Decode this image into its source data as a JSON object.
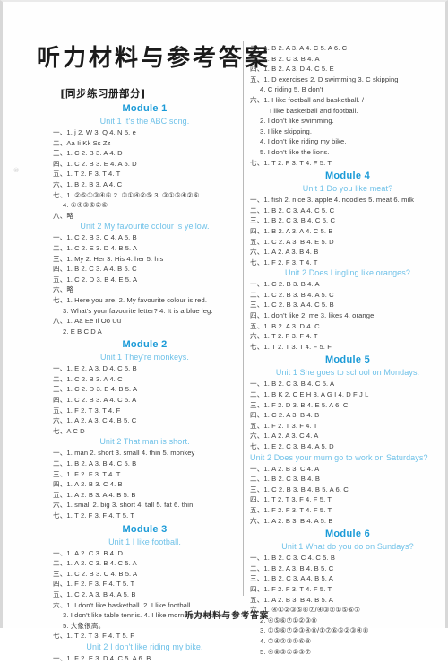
{
  "document": {
    "title": "听力材料与参考答案",
    "section_tag": "[同步练习册部分]",
    "footer": "听力材料与参考答案",
    "watermark": "",
    "edge_mark": "⑩",
    "accent_color": "#1a9ad7",
    "unit_color": "#6ec1e8"
  },
  "left_column": [
    {
      "type": "module",
      "text": "Module 1"
    },
    {
      "type": "unit",
      "text": "Unit 1   It's the ABC song."
    },
    {
      "type": "answer",
      "text": "一、1. j   2. W   3. Q   4. N   5. e"
    },
    {
      "type": "answer",
      "text": "二、Aa   Ii   Kk   Ss   Zz"
    },
    {
      "type": "answer",
      "text": "三、1. C   2. B   3. A   4. D"
    },
    {
      "type": "answer",
      "text": "四、1. C   2. B   3. E   4. A   5. D"
    },
    {
      "type": "answer",
      "text": "五、1. T   2. F   3. T   4. T"
    },
    {
      "type": "answer",
      "text": "六、1. B   2. B   3. A   4. C"
    },
    {
      "type": "answer",
      "text": "七、1. ②⑤①③④⑥   2. ③①④②⑤   3. ③①⑤④②⑥"
    },
    {
      "type": "answer_indent",
      "text": "4. ①④③⑤②⑥"
    },
    {
      "type": "answer",
      "text": "八、略"
    },
    {
      "type": "unit",
      "text": "Unit 2   My favourite colour is yellow."
    },
    {
      "type": "answer",
      "text": "一、1. C   2. B   3. C   4. A   5. B"
    },
    {
      "type": "answer",
      "text": "二、1. C   2. E   3. D   4. B   5. A"
    },
    {
      "type": "answer",
      "text": "三、1. My   2. Her   3. His   4. her   5. his"
    },
    {
      "type": "answer",
      "text": "四、1. B   2. C   3. A   4. B   5. C"
    },
    {
      "type": "answer",
      "text": "五、1. C   2. D   3. B   4. E   5. A"
    },
    {
      "type": "answer",
      "text": "六、略"
    },
    {
      "type": "answer",
      "text": "七、1. Here you are.    2. My favourite colour is red."
    },
    {
      "type": "answer_indent",
      "text": "3. What's your favourite letter?    4. It is a blue leg."
    },
    {
      "type": "answer",
      "text": "八、1. Aa   Ee   Ii   Oo   Uu"
    },
    {
      "type": "answer_indent",
      "text": "2. E   B   C   D   A"
    },
    {
      "type": "module",
      "text": "Module 2"
    },
    {
      "type": "unit",
      "text": "Unit 1   They're monkeys."
    },
    {
      "type": "answer",
      "text": "一、1. E   2. A   3. D   4. C   5. B"
    },
    {
      "type": "answer",
      "text": "二、1. C   2. B   3. A   4. C"
    },
    {
      "type": "answer",
      "text": "三、1. C   2. D   3. E   4. B   5. A"
    },
    {
      "type": "answer",
      "text": "四、1. C   2. B   3. A   4. C   5. A"
    },
    {
      "type": "answer",
      "text": "五、1. F   2. T   3. T   4. F"
    },
    {
      "type": "answer",
      "text": "六、1. A   2. A   3. C   4. B   5. C"
    },
    {
      "type": "answer",
      "text": "七、A   C   D"
    },
    {
      "type": "unit",
      "text": "Unit 2   That man is short."
    },
    {
      "type": "answer",
      "text": "一、1. man   2. short   3. small   4. thin   5. monkey"
    },
    {
      "type": "answer",
      "text": "二、1. B   2. A   3. B   4. C   5. B"
    },
    {
      "type": "answer",
      "text": "三、1. F   2. F   3. T   4. T"
    },
    {
      "type": "answer",
      "text": "四、1. A   2. B   3. C   4. B"
    },
    {
      "type": "answer",
      "text": "五、1. A   2. B   3. A   4. B   5. B"
    },
    {
      "type": "answer",
      "text": "六、1. small   2. big   3. short   4. tall   5. fat   6. thin"
    },
    {
      "type": "answer",
      "text": "七、1. T   2. F   3. F   4. T   5. T"
    },
    {
      "type": "module",
      "text": "Module 3"
    },
    {
      "type": "unit",
      "text": "Unit 1   I like football."
    },
    {
      "type": "answer",
      "text": "一、1. A   2. C   3. B   4. D"
    },
    {
      "type": "answer",
      "text": "二、1. A   2. C   3. B   4. C   5. A"
    },
    {
      "type": "answer",
      "text": "三、1. C   2. B   3. C   4. B   5. A"
    },
    {
      "type": "answer",
      "text": "四、1. F   2. F   3. F   4. T   5. T"
    },
    {
      "type": "answer",
      "text": "五、1. C   2. A   3. B   4. A   5. B"
    },
    {
      "type": "answer",
      "text": "六、1. I don't like basketball.    2. I like football."
    },
    {
      "type": "answer_indent",
      "text": "3. I don't like table tennis.    4. I like morning exercises."
    },
    {
      "type": "answer_indent",
      "text": "5. 大象很高。"
    },
    {
      "type": "answer",
      "text": "七、1. T   2. T   3. F   4. T   5. F"
    },
    {
      "type": "unit",
      "text": "Unit 2   I don't like riding my bike."
    },
    {
      "type": "answer",
      "text": "一、1. F   2. E   3. D   4. C   5. A   6. B"
    }
  ],
  "right_column": [
    {
      "type": "answer",
      "text": "二、1. B   2. A   3. A   4. C   5. A   6. C"
    },
    {
      "type": "answer",
      "text": "三、1. B   2. C   3. B   4. A"
    },
    {
      "type": "answer",
      "text": "四、1. B   2. A   3. D   4. C   5. E"
    },
    {
      "type": "answer",
      "text": "五、1. D   exercises   2. D   swimming   3. C   skipping"
    },
    {
      "type": "answer_indent",
      "text": "4. C   riding   5. B   don't"
    },
    {
      "type": "answer",
      "text": "六、1. I like football and basketball. /"
    },
    {
      "type": "answer_indent2",
      "text": "I like basketball and football."
    },
    {
      "type": "answer_indent",
      "text": "2. I don't like swimming."
    },
    {
      "type": "answer_indent",
      "text": "3. I like skipping."
    },
    {
      "type": "answer_indent",
      "text": "4. I don't like riding my bike."
    },
    {
      "type": "answer_indent",
      "text": "5. I don't like the lions."
    },
    {
      "type": "answer",
      "text": "七、1. T   2. F   3. T   4. F   5. T"
    },
    {
      "type": "module",
      "text": "Module 4"
    },
    {
      "type": "unit",
      "text": "Unit 1   Do you like meat?"
    },
    {
      "type": "answer",
      "text": "一、1. fish   2. nice   3. apple   4. noodles   5. meat   6. milk"
    },
    {
      "type": "answer",
      "text": "二、1. B   2. C   3. A   4. C   5. C"
    },
    {
      "type": "answer",
      "text": "三、1. B   2. C   3. B   4. C   5. C"
    },
    {
      "type": "answer",
      "text": "四、1. B   2. A   3. A   4. C   5. B"
    },
    {
      "type": "answer",
      "text": "五、1. C   2. A   3. B   4. E   5. D"
    },
    {
      "type": "answer",
      "text": "六、1. A   2. A   3. B   4. B"
    },
    {
      "type": "answer",
      "text": "七、1. F   2. F   3. T   4. T"
    },
    {
      "type": "unit",
      "text": "Unit 2   Does Lingling like oranges?"
    },
    {
      "type": "answer",
      "text": "一、1. C   2. B   3. B   4. A"
    },
    {
      "type": "answer",
      "text": "二、1. C   2. B   3. B   4. A   5. C"
    },
    {
      "type": "answer",
      "text": "三、1. C   2. B   3. A   4. C   5. B"
    },
    {
      "type": "answer",
      "text": "四、1. don't like   2. me   3. likes   4. orange"
    },
    {
      "type": "answer",
      "text": "五、1. B   2. A   3. D   4. C"
    },
    {
      "type": "answer",
      "text": "六、1. T   2. F   3. F   4. T"
    },
    {
      "type": "answer",
      "text": "七、1. T   2. T   3. T   4. F   5. F"
    },
    {
      "type": "module",
      "text": "Module 5"
    },
    {
      "type": "unit",
      "text": "Unit 1   She goes to school on Mondays."
    },
    {
      "type": "answer",
      "text": "一、1. B   2. C   3. B   4. C   5. A"
    },
    {
      "type": "answer",
      "text": "二、1. B K   2. C E H   3. A G I   4. D F J L"
    },
    {
      "type": "answer",
      "text": "三、1. F   2. D   3. B   4. E   5. A   6. C"
    },
    {
      "type": "answer",
      "text": "四、1. C   2. A   3. B   4. B"
    },
    {
      "type": "answer",
      "text": "五、1. F   2. T   3. F   4. T"
    },
    {
      "type": "answer",
      "text": "六、1. A   2. A   3. C   4. A"
    },
    {
      "type": "answer",
      "text": "七、1. E   2. C   3. B   4. A   5. D"
    },
    {
      "type": "unit_left",
      "text": "Unit 2   Does your mum go to work on Saturdays?"
    },
    {
      "type": "answer",
      "text": "一、1. A   2. B   3. C   4. A"
    },
    {
      "type": "answer",
      "text": "二、1. B   2. C   3. B   4. B"
    },
    {
      "type": "answer",
      "text": "三、1. C   2. B   3. B   4. B   5. A   6. C"
    },
    {
      "type": "answer",
      "text": "四、1. T   2. T   3. F   4. F   5. T"
    },
    {
      "type": "answer",
      "text": "五、1. F   2. F   3. T   4. F   5. T"
    },
    {
      "type": "answer",
      "text": "六、1. A   2. B   3. B   4. A   5. B"
    },
    {
      "type": "module",
      "text": "Module 6"
    },
    {
      "type": "unit",
      "text": "Unit 1   What do you do on Sundays?"
    },
    {
      "type": "answer",
      "text": "一、1. B   2. C   3. C   4. C   5. B"
    },
    {
      "type": "answer",
      "text": "二、1. B   2. A   3. B   4. B   5. C"
    },
    {
      "type": "answer",
      "text": "三、1. B   2. C   3. A   4. B   5. A"
    },
    {
      "type": "answer",
      "text": "四、1. F   2. F   3. T   4. F   5. T"
    },
    {
      "type": "answer",
      "text": "五、1. A   2. B   3. B   4. B   5. A"
    },
    {
      "type": "answer",
      "text": "六、1. ④①②③⑤⑥⑦/④③②①⑤⑥⑦"
    },
    {
      "type": "answer_indent",
      "text": "2. ④⑤⑥⑦①②③⑧"
    },
    {
      "type": "answer_indent",
      "text": "3. ①⑤⑥⑦②③④⑧/①⑦⑥⑤②③④⑧"
    },
    {
      "type": "answer_indent",
      "text": "4.   ⑦④②③①⑥⑧"
    },
    {
      "type": "answer_indent",
      "text": "5. ④⑧⑤①②③⑦"
    }
  ]
}
